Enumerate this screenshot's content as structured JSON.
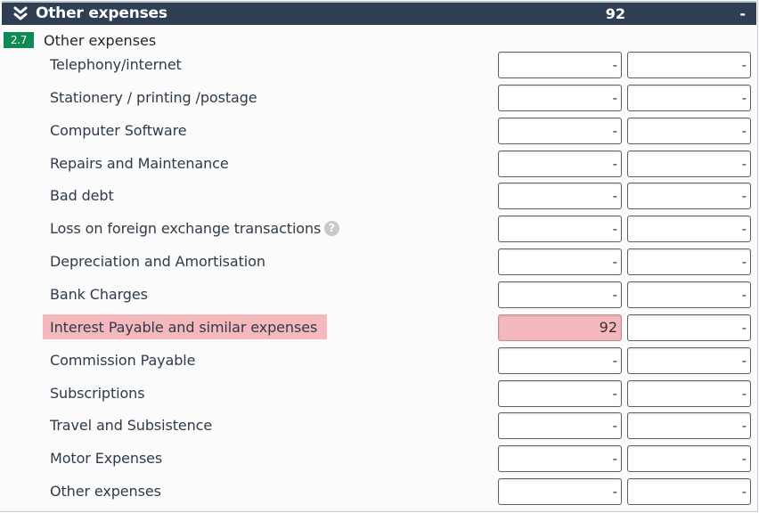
{
  "header": {
    "title": "Other expenses",
    "total": "92",
    "total2": "-"
  },
  "section": {
    "badge": "2.7",
    "title": "Other expenses"
  },
  "rows": [
    {
      "label": "Telephony/internet",
      "v1": "-",
      "v2": "-"
    },
    {
      "label": "Stationery / printing /postage",
      "v1": "-",
      "v2": "-"
    },
    {
      "label": "Computer Software",
      "v1": "-",
      "v2": "-"
    },
    {
      "label": "Repairs and Maintenance",
      "v1": "-",
      "v2": "-"
    },
    {
      "label": "Bad debt",
      "v1": "-",
      "v2": "-"
    },
    {
      "label": "Loss on foreign exchange transactions",
      "v1": "-",
      "v2": "-",
      "help": "?"
    },
    {
      "label": "Depreciation and Amortisation",
      "v1": "-",
      "v2": "-"
    },
    {
      "label": "Bank Charges",
      "v1": "-",
      "v2": "-"
    },
    {
      "label": "Interest Payable and similar expenses",
      "v1": "92",
      "v2": "-",
      "highlight": true
    },
    {
      "label": "Commission Payable",
      "v1": "-",
      "v2": "-"
    },
    {
      "label": "Subscriptions",
      "v1": "-",
      "v2": "-"
    },
    {
      "label": "Travel and Subsistence",
      "v1": "-",
      "v2": "-"
    },
    {
      "label": "Motor Expenses",
      "v1": "-",
      "v2": "-"
    },
    {
      "label": "Other expenses",
      "v1": "-",
      "v2": "-"
    }
  ],
  "colors": {
    "header_bg": "#2f3e52",
    "badge_bg": "#0f8a55",
    "highlight_bg": "#f4b8bd"
  }
}
